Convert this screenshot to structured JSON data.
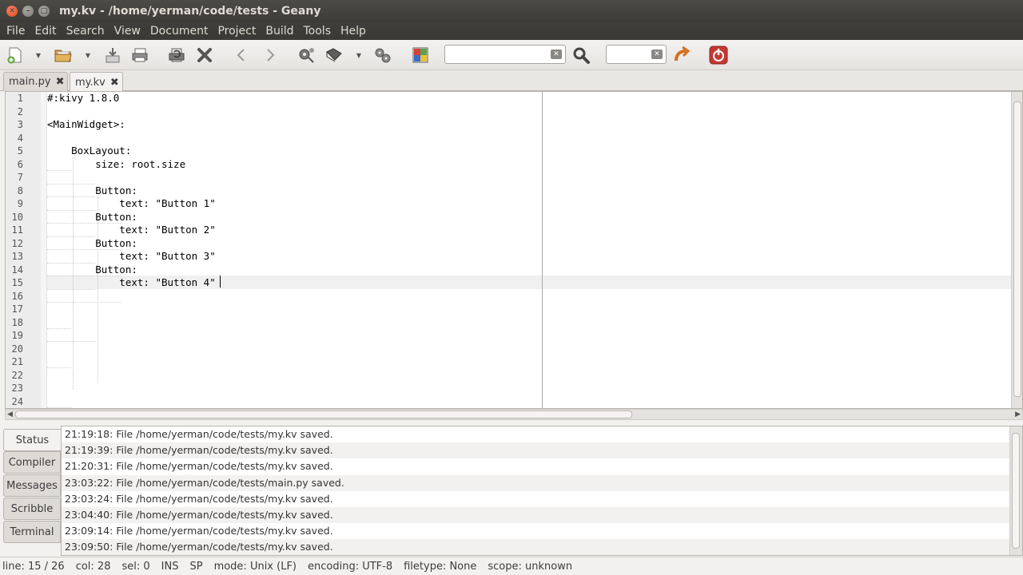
{
  "window": {
    "title": "my.kv - /home/yerman/code/tests - Geany"
  },
  "menu": [
    "File",
    "Edit",
    "Search",
    "View",
    "Document",
    "Project",
    "Build",
    "Tools",
    "Help"
  ],
  "toolbar": {
    "search_value": "",
    "goto_value": "",
    "icons": [
      "new-file-icon",
      "open-file-icon",
      "save-icon",
      "save-all-icon",
      "revert-icon",
      "close-icon",
      "back-icon",
      "forward-icon",
      "compile-icon",
      "build-icon",
      "run-icon",
      "color-chooser-icon",
      "search-icon",
      "jump-icon",
      "quit-icon"
    ]
  },
  "tabs": [
    {
      "label": "main.py",
      "active": false
    },
    {
      "label": "my.kv",
      "active": true
    }
  ],
  "editor": {
    "line_numbers": [
      "1",
      "2",
      "3",
      "4",
      "5",
      "6",
      "7",
      "8",
      "9",
      "10",
      "11",
      "12",
      "13",
      "14",
      "15",
      "16",
      "17",
      "18",
      "19",
      "20",
      "21",
      "22",
      "23",
      "24"
    ],
    "lines": [
      "#:kivy 1.8.0",
      "",
      "<MainWidget>:",
      "",
      "    BoxLayout:",
      "        size: root.size",
      "",
      "        Button:",
      "            text: \"Button 1\"",
      "        Button:",
      "            text: \"Button 2\"",
      "        Button:",
      "            text: \"Button 3\"",
      "        Button:",
      "            text: \"Button 4\"",
      "",
      "",
      "",
      "",
      "",
      "",
      "",
      "",
      ""
    ],
    "current_line": 15
  },
  "message_tabs": [
    "Status",
    "Compiler",
    "Messages",
    "Scribble",
    "Terminal"
  ],
  "messages": [
    "21:19:18: File /home/yerman/code/tests/my.kv saved.",
    "21:19:39: File /home/yerman/code/tests/my.kv saved.",
    "21:20:31: File /home/yerman/code/tests/my.kv saved.",
    "23:03:22: File /home/yerman/code/tests/main.py saved.",
    "23:03:24: File /home/yerman/code/tests/my.kv saved.",
    "23:04:40: File /home/yerman/code/tests/my.kv saved.",
    "23:09:14: File /home/yerman/code/tests/my.kv saved.",
    "23:09:50: File /home/yerman/code/tests/my.kv saved."
  ],
  "status": {
    "line": "line: 15 / 26",
    "col": "col: 28",
    "sel": "sel: 0",
    "ins": "INS",
    "sp": "SP",
    "mode": "mode: Unix (LF)",
    "encoding": "encoding: UTF-8",
    "filetype": "filetype: None",
    "scope": "scope: unknown"
  }
}
